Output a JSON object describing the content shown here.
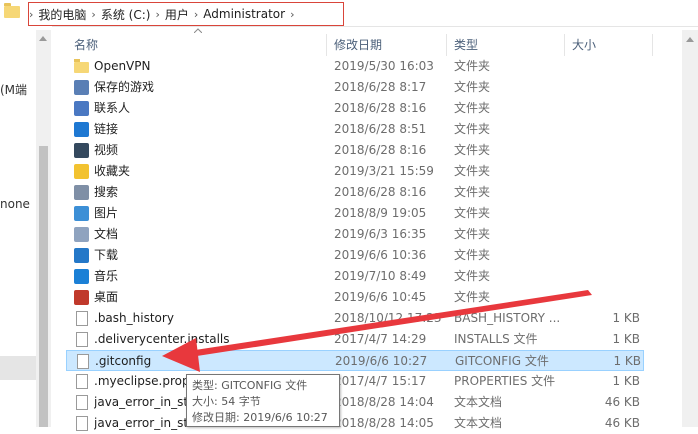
{
  "breadcrumb": {
    "items": [
      "我的电脑",
      "系统 (C:)",
      "用户",
      "Administrator"
    ],
    "separator": "›"
  },
  "nav": {
    "partial_top": "(M端",
    "partial_mid": "none"
  },
  "columns": {
    "name": "名称",
    "date": "修改日期",
    "type": "类型",
    "size": "大小"
  },
  "rows": [
    {
      "name": "OpenVPN",
      "date": "2019/5/30 16:03",
      "type": "文件夹",
      "size": "",
      "icon": "folder-icon",
      "color": "#f6d776"
    },
    {
      "name": "保存的游戏",
      "date": "2018/6/28 8:17",
      "type": "文件夹",
      "size": "",
      "icon": "saved-games-icon",
      "color": "#5a7fb5"
    },
    {
      "name": "联系人",
      "date": "2018/6/28 8:16",
      "type": "文件夹",
      "size": "",
      "icon": "contacts-icon",
      "color": "#4a78c2"
    },
    {
      "name": "链接",
      "date": "2018/6/28 8:51",
      "type": "文件夹",
      "size": "",
      "icon": "links-icon",
      "color": "#1e78d2"
    },
    {
      "name": "视频",
      "date": "2018/6/28 8:16",
      "type": "文件夹",
      "size": "",
      "icon": "videos-icon",
      "color": "#34495e"
    },
    {
      "name": "收藏夹",
      "date": "2019/3/21 15:59",
      "type": "文件夹",
      "size": "",
      "icon": "favorites-icon",
      "color": "#f2c230"
    },
    {
      "name": "搜索",
      "date": "2018/6/28 8:16",
      "type": "文件夹",
      "size": "",
      "icon": "search-icon",
      "color": "#7f8fa6"
    },
    {
      "name": "图片",
      "date": "2018/8/9 19:05",
      "type": "文件夹",
      "size": "",
      "icon": "pictures-icon",
      "color": "#3c8fd6"
    },
    {
      "name": "文档",
      "date": "2019/6/3 16:35",
      "type": "文件夹",
      "size": "",
      "icon": "documents-icon",
      "color": "#8fa3bf"
    },
    {
      "name": "下载",
      "date": "2019/6/6 10:36",
      "type": "文件夹",
      "size": "",
      "icon": "downloads-icon",
      "color": "#2478c8"
    },
    {
      "name": "音乐",
      "date": "2019/7/10 8:49",
      "type": "文件夹",
      "size": "",
      "icon": "music-icon",
      "color": "#1b80d6"
    },
    {
      "name": "桌面",
      "date": "2019/6/6 10:45",
      "type": "文件夹",
      "size": "",
      "icon": "desktop-icon",
      "color": "#c0392b"
    },
    {
      "name": ".bash_history",
      "date": "2018/10/12 17:23",
      "type": "BASH_HISTORY ...",
      "size": "1 KB",
      "icon": "file-icon",
      "color": "#ffffff"
    },
    {
      "name": ".deliverycenter.installs",
      "date": "2017/4/7 14:29",
      "type": "INSTALLS 文件",
      "size": "1 KB",
      "icon": "file-icon",
      "color": "#ffffff"
    },
    {
      "name": ".gitconfig",
      "date": "2019/6/6 10:27",
      "type": "GITCONFIG 文件",
      "size": "1 KB",
      "icon": "file-icon",
      "color": "#ffffff",
      "selected": true
    },
    {
      "name": ".myeclipse.prop",
      "date": "2017/4/7 15:17",
      "type": "PROPERTIES 文件",
      "size": "1 KB",
      "icon": "file-icon",
      "color": "#ffffff"
    },
    {
      "name": "java_error_in_stu",
      "date": "2018/8/28 14:04",
      "type": "文本文档",
      "size": "46 KB",
      "icon": "file-icon",
      "color": "#ffffff"
    },
    {
      "name": "java_error_in_stu",
      "date": "2018/8/28 14:05",
      "type": "文本文档",
      "size": "46 KB",
      "icon": "file-icon",
      "color": "#ffffff"
    }
  ],
  "tooltip": {
    "type": "类型: GITCONFIG 文件",
    "size": "大小: 54 字节",
    "date": "修改日期: 2019/6/6 10:27"
  },
  "colors": {
    "highlight_border": "#d9453a",
    "arrow": "#e8383d",
    "selection": "#cce8ff"
  }
}
